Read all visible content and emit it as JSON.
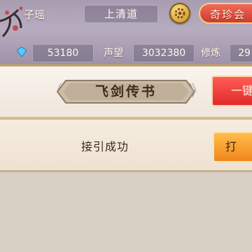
{
  "header": {
    "player_name": "子瑶",
    "sect_title": "上清道",
    "event_button": "奇珍会",
    "currency": "53180",
    "reputation_label": "声望",
    "reputation_value": "3032380",
    "cultivation_label": "修炼",
    "cultivation_value": "29"
  },
  "tab": {
    "title": "飞剑传书",
    "left_arrow": "《",
    "right_arrow": "》",
    "action_button": "一键"
  },
  "message": {
    "text": "接引成功",
    "button": "打"
  },
  "colors": {
    "header_bg": "#b0a5b9",
    "accent_red": "#e02a2a",
    "accent_orange": "#f2861c",
    "gold": "#c7a35a"
  }
}
